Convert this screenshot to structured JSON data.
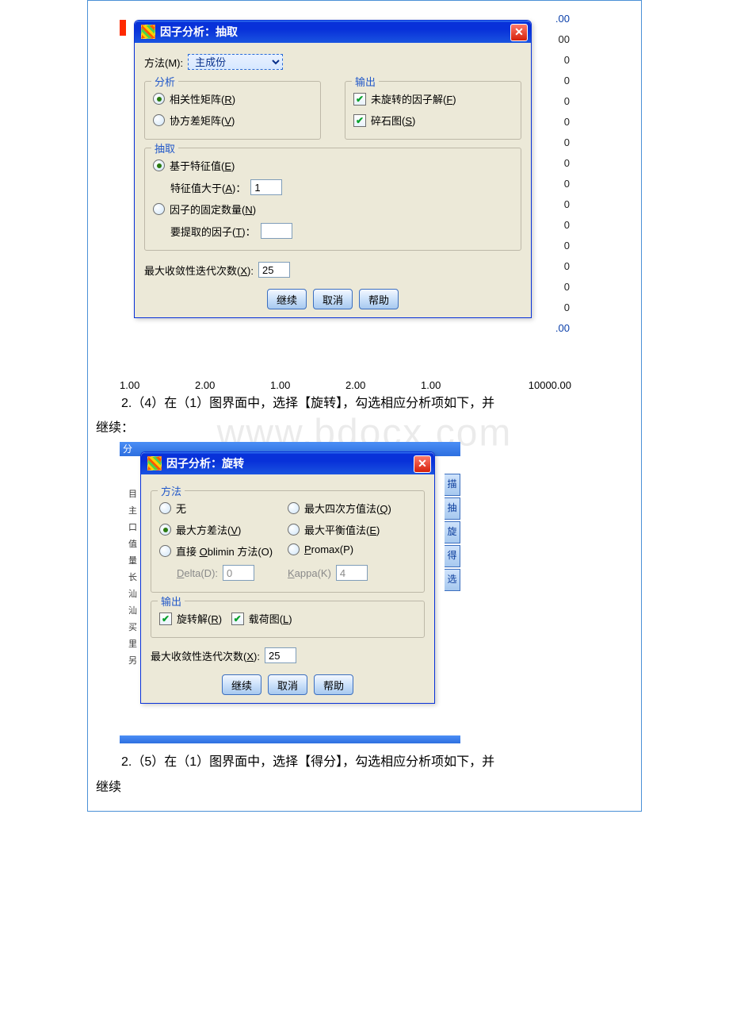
{
  "dialog1": {
    "title": "因子分析：抽取",
    "method_label": "方法(M):",
    "method_value": "主成份",
    "group_analysis": {
      "legend": "分析",
      "opt_corr": "相关性矩阵(R)",
      "opt_cov": "协方差矩阵(V)"
    },
    "group_output": {
      "legend": "输出",
      "chk_unrotated": "未旋转的因子解(F)",
      "chk_scree": "碎石图(S)"
    },
    "group_extract": {
      "legend": "抽取",
      "opt_eigen": "基于特征值(E)",
      "eigen_gt_label": "特征值大于(A)：",
      "eigen_gt_value": "1",
      "opt_fixed": "因子的固定数量(N)",
      "fixed_label": "要提取的因子(T)：",
      "fixed_value": ""
    },
    "max_iter_label": "最大收敛性迭代次数(X):",
    "max_iter_value": "25",
    "btn_continue": "继续",
    "btn_cancel": "取消",
    "btn_help": "帮助"
  },
  "right_numbers": [
    ".00",
    "00",
    "0",
    "0",
    "0",
    "0",
    "0",
    "0",
    "0",
    "0",
    "0",
    "0",
    "0",
    "0",
    "0",
    ".00"
  ],
  "axis": {
    "a": "1.00",
    "b": "2.00",
    "c": "1.00",
    "d": "2.00",
    "e": "1.00",
    "f": "10000.00"
  },
  "para1_indent": "2.（4）在（1）图界面中，选择【旋转】，勾选相应分析项如下，并",
  "para1_line2": "继续：",
  "watermark": "www.bdocx.com",
  "dialog2": {
    "strip_top_label": "分",
    "title": "因子分析：旋转",
    "group_method": {
      "legend": "方法",
      "opt_none": "无",
      "opt_quartimax": "最大四次方值法(Q)",
      "opt_varimax": "最大方差法(V)",
      "opt_equamax": "最大平衡值法(E)",
      "opt_oblimin": "直接 Oblimin 方法(O)",
      "opt_promax": "Promax(P)",
      "delta_label": "Delta(D):",
      "delta_value": "0",
      "kappa_label": "Kappa(K)",
      "kappa_value": "4"
    },
    "group_output": {
      "legend": "输出",
      "chk_rot": "旋转解(R)",
      "chk_load": "载荷图(L)"
    },
    "max_iter_label": "最大收敛性迭代次数(X):",
    "max_iter_value": "25",
    "btn_continue": "继续",
    "btn_cancel": "取消",
    "btn_help": "帮助"
  },
  "left_strip": [
    "目",
    "主",
    "口",
    "值",
    "量",
    "长",
    "汕",
    "汕",
    "买",
    "里",
    "另"
  ],
  "right_vtabs": [
    "描",
    "抽",
    "旋",
    "得",
    "选"
  ],
  "para2_indent": "2.（5）在（1）图界面中，选择【得分】，勾选相应分析项如下，并",
  "para2_line2": "继续"
}
